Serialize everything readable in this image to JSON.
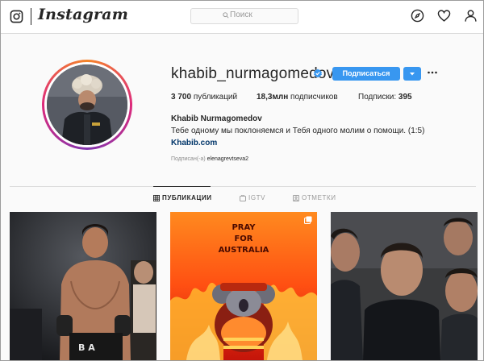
{
  "header": {
    "app_name": "Instagram",
    "search_placeholder": "Поиск",
    "icons": [
      "instagram-icon",
      "search-icon",
      "compass-icon",
      "heart-icon",
      "person-icon"
    ]
  },
  "profile": {
    "username": "khabib_nurmagomedov",
    "verified": true,
    "follow_label": "Подписаться",
    "stats": {
      "posts_value": "3 700",
      "posts_label": "публикаций",
      "followers_value": "18,3млн",
      "followers_label": "подписчиков",
      "following_label": "Подписки:",
      "following_value": "395"
    },
    "full_name": "Khabib Nurmagomedov",
    "bio": "Тебе одному мы поклоняемся и Тебя одного молим о помощи. (1:5)",
    "website": "Khabib.com",
    "followed_by_label": "Подписан(-а)",
    "followed_by_user": "elenagrevtseva2"
  },
  "tabs": [
    {
      "label": "ПУБЛИКАЦИИ",
      "icon": "grid-icon",
      "active": true
    },
    {
      "label": "IGTV",
      "icon": "tv-icon",
      "active": false
    },
    {
      "label": "ОТМЕТКИ",
      "icon": "tag-icon",
      "active": false
    }
  ],
  "posts": [
    {
      "kind": "photo",
      "jersey_text": "B A"
    },
    {
      "kind": "artwork",
      "caption": [
        "PRAY",
        "FOR",
        "AUSTRALIA"
      ],
      "multi_icon": "carousel-icon"
    },
    {
      "kind": "photo"
    }
  ],
  "colors": {
    "accent": "#3897f0",
    "link": "#003569",
    "border": "#dbdbdb",
    "muted": "#8e8e8e"
  }
}
